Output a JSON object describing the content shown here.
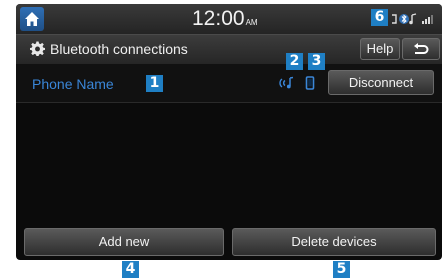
{
  "status_bar": {
    "time": "12:00",
    "ampm": "AM"
  },
  "title_bar": {
    "title": "Bluetooth connections",
    "help_label": "Help"
  },
  "device": {
    "name": "Phone Name",
    "disconnect_label": "Disconnect"
  },
  "footer": {
    "add_label": "Add new",
    "delete_label": "Delete devices"
  },
  "callouts": [
    "1",
    "2",
    "3",
    "4",
    "5",
    "6"
  ],
  "colors": {
    "accent_blue": "#1f7fc4",
    "device_name_blue": "#3a86d8",
    "screen_bg": "#0b0b0b"
  },
  "icons": [
    "home-icon",
    "gear-icon",
    "back-icon",
    "audio-streaming-icon",
    "phone-icon",
    "bluetooth-icon",
    "signal-icon",
    "battery-icon"
  ]
}
